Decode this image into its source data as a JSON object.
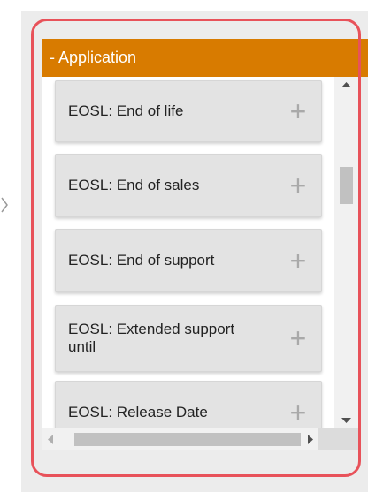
{
  "panel": {
    "header_label": "- Application"
  },
  "items": [
    {
      "label": "EOSL: End of life"
    },
    {
      "label": "EOSL: End of sales"
    },
    {
      "label": "EOSL: End of support"
    },
    {
      "label": "EOSL: Extended support until"
    },
    {
      "label": "EOSL: Release Date"
    }
  ],
  "icons": {
    "add": "plus-icon",
    "left_pointer": "chevron-left-icon",
    "scroll_up": "triangle-up-icon",
    "scroll_down": "triangle-down-icon",
    "scroll_left": "triangle-left-icon",
    "scroll_right": "triangle-right-icon"
  },
  "colors": {
    "header_bg": "#d87b00",
    "header_text": "#ffffff",
    "highlight_border": "#e8525a",
    "item_bg": "#e3e3e3",
    "plus_color": "#a9a9a9"
  },
  "scroll": {
    "vertical_position": 0.3,
    "horizontal_position": 0.15
  }
}
